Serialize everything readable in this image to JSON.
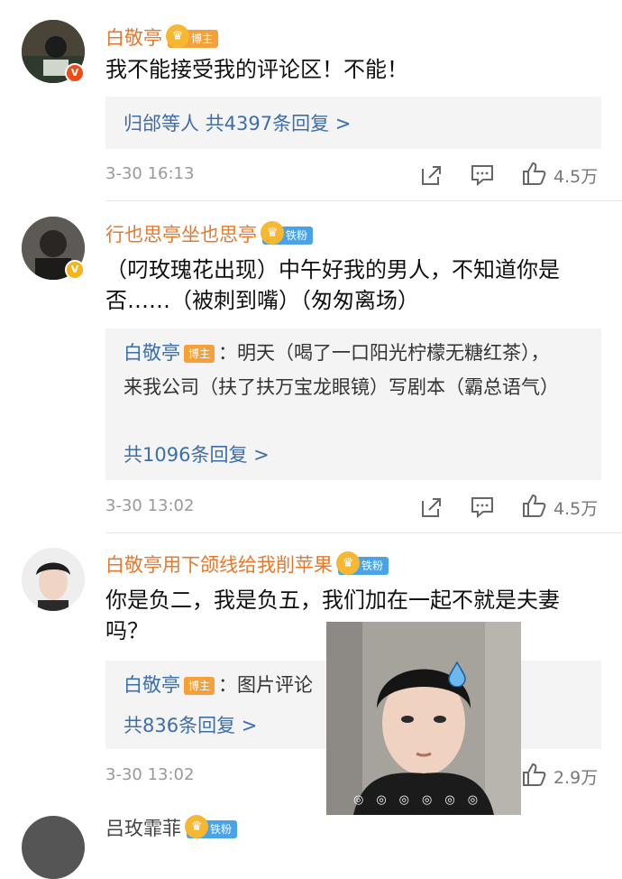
{
  "comments": [
    {
      "author": "白敬亭",
      "badge": "博主",
      "text": "我不能接受我的评论区！不能！",
      "replies_summary": "归邰等人 共4397条回复 >",
      "time": "3-30 16:13",
      "likes": "4.5万",
      "verified": "red"
    },
    {
      "author": "行也思亭坐也思亭",
      "badge": "铁粉",
      "text": "（叼玫瑰花出现）中午好我的男人，不知道你是否……（被刺到嘴）（匆匆离场）",
      "reply_author": "白敬亭",
      "reply_badge": "博主",
      "reply_text": "：明天（喝了一口阳光柠檬无糖红茶），来我公司（扶了扶万宝龙眼镜）写剧本（霸总语气）",
      "replies_count": "共1096条回复 >",
      "time": "3-30 13:02",
      "likes": "4.5万",
      "verified": "gold"
    },
    {
      "author": "白敬亭用下颌线给我削苹果",
      "badge": "铁粉",
      "text": "你是负二，我是负五，我们加在一起不就是夫妻吗？",
      "reply_author": "白敬亭",
      "reply_badge": "博主",
      "reply_text": "：图片评论",
      "replies_count": "共836条回复 >",
      "time": "3-30 13:02",
      "likes": "2.9万"
    },
    {
      "author": "吕玫霏菲",
      "badge": "铁粉"
    }
  ],
  "colors": {
    "username": "#e8792c",
    "link_blue": "#3d6ea8",
    "reply_bg": "#f4f4f4",
    "meta_gray": "#999999"
  },
  "icons": [
    "share-icon",
    "comment-icon",
    "like-icon",
    "crown-icon",
    "verified-icon",
    "sweat-drop-icon"
  ]
}
